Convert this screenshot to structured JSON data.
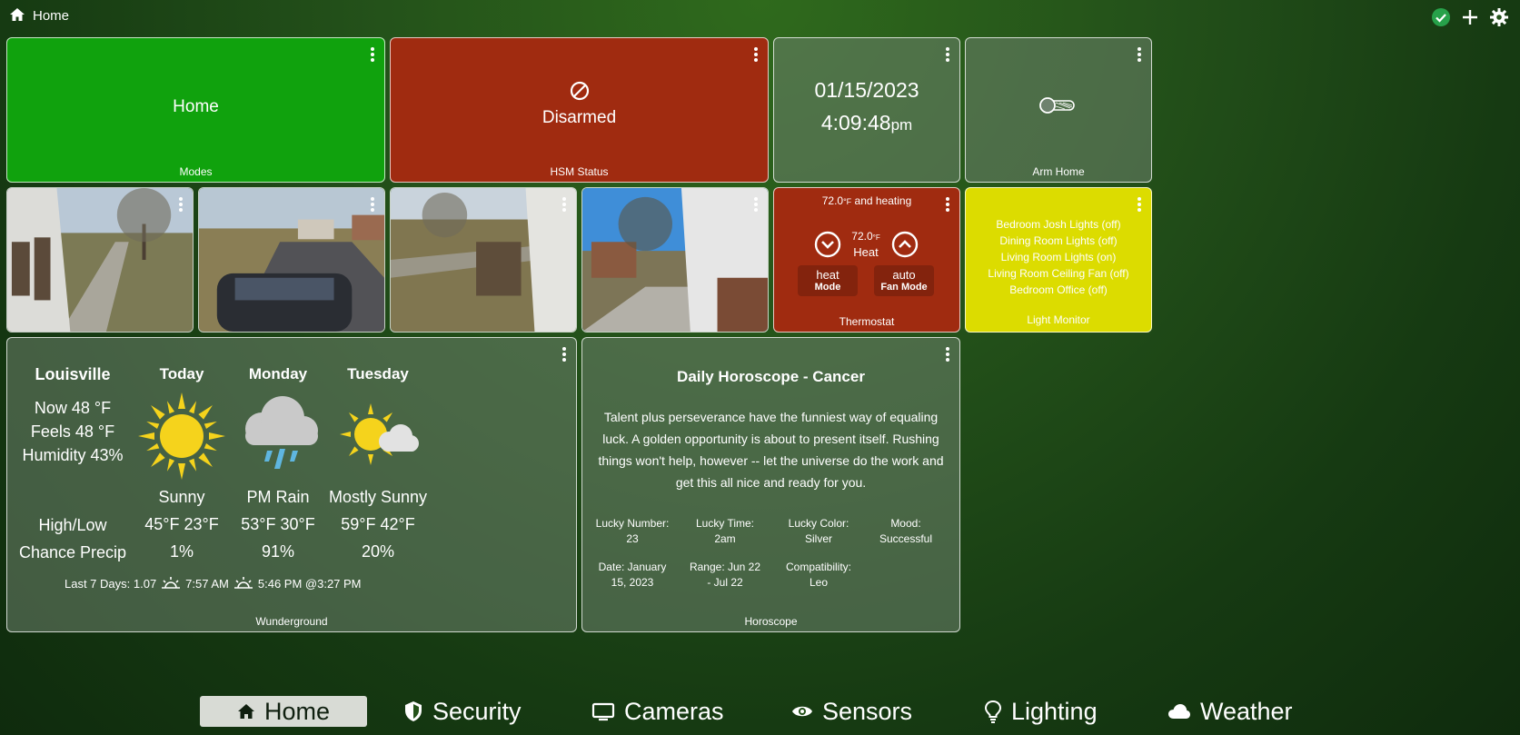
{
  "topbar": {
    "title": "Home",
    "icons": [
      "home-icon",
      "check-circle-icon",
      "plus-icon",
      "gear-icon"
    ]
  },
  "tiles": {
    "modes": {
      "value": "Home",
      "label": "Modes"
    },
    "hsm": {
      "value": "Disarmed",
      "label": "HSM Status",
      "icon": "prohibited-icon"
    },
    "clock": {
      "date": "01/15/2023",
      "time": "4:09:48",
      "ampm": "pm"
    },
    "arm_home": {
      "label": "Arm Home",
      "icon": "toggle-off-icon"
    },
    "thermostat": {
      "status_temp": "72.0",
      "status_unit": "°F",
      "status_text": "and heating",
      "setpoint": "72.0",
      "setpoint_unit": "°F",
      "setpoint_mode": "Heat",
      "mode_value": "heat",
      "mode_label": "Mode",
      "fan_value": "auto",
      "fan_label": "Fan Mode",
      "label": "Thermostat"
    },
    "light_monitor": {
      "items": [
        "Bedroom Josh Lights (off)",
        "Dining Room Lights (off)",
        "Living Room Lights (on)",
        "Living Room Ceiling Fan (off)",
        "Bedroom Office (off)"
      ],
      "label": "Light Monitor"
    },
    "weather": {
      "city": "Louisville",
      "now": "Now 48 °F",
      "feels": "Feels 48 °F",
      "humidity": "Humidity 43%",
      "highlow_label": "High/Low",
      "precip_label": "Chance Precip",
      "days": [
        {
          "name": "Today",
          "cond": "Sunny",
          "hl": "45°F 23°F",
          "precip": "1%",
          "icon": "sun-icon"
        },
        {
          "name": "Monday",
          "cond": "PM Rain",
          "hl": "53°F 30°F",
          "precip": "91%",
          "icon": "rain-cloud-icon"
        },
        {
          "name": "Tuesday",
          "cond": "Mostly Sunny",
          "hl": "59°F 42°F",
          "precip": "20%",
          "icon": "partly-sunny-icon"
        }
      ],
      "footer_rain": "Last 7 Days: 1.07",
      "sunrise": "7:57 AM",
      "sunset": "5:46 PM @3:27 PM",
      "label": "Wunderground"
    },
    "horoscope": {
      "title": "Daily Horoscope - Cancer",
      "text": "Talent plus perseverance have the funniest way of equaling luck. A golden opportunity is about to present itself. Rushing things won't help, however -- let the universe do the work and get this all nice and ready for you.",
      "lucky_number": "Lucky Number: 23",
      "lucky_time": "Lucky Time: 2am",
      "lucky_color": "Lucky Color: Silver",
      "mood": "Mood: Successful",
      "date": "Date: January 15, 2023",
      "range": "Range: Jun 22 - Jul 22",
      "compat": "Compatibility: Leo",
      "label": "Horoscope"
    }
  },
  "nav": [
    {
      "label": "Home",
      "icon": "home-icon",
      "active": true
    },
    {
      "label": "Security",
      "icon": "shield-icon"
    },
    {
      "label": "Cameras",
      "icon": "monitor-icon"
    },
    {
      "label": "Sensors",
      "icon": "eye-icon"
    },
    {
      "label": "Lighting",
      "icon": "lightbulb-icon"
    },
    {
      "label": "Weather",
      "icon": "cloud-icon"
    }
  ]
}
